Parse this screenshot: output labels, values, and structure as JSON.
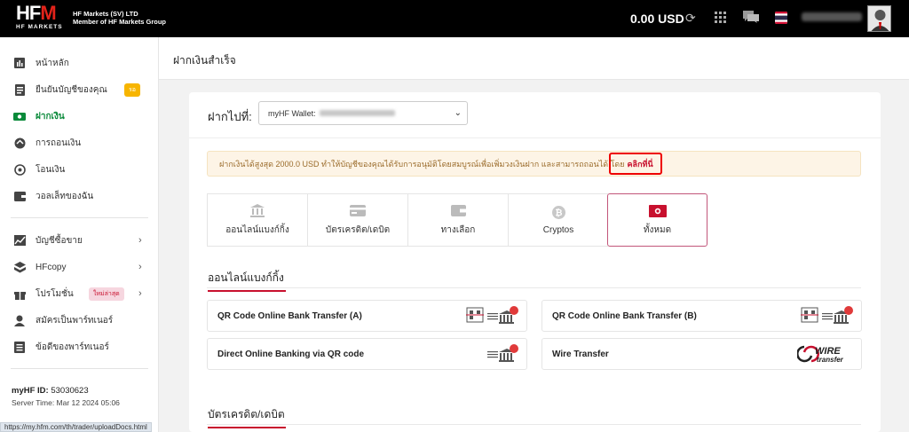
{
  "header": {
    "logo_text_main": "HF",
    "logo_text_m": "M",
    "logo_sub": "HF MARKETS",
    "company_line1": "HF Markets (SV) LTD",
    "company_line2": "Member of HF Markets Group",
    "balance": "0.00 USD",
    "icons": [
      "refresh-icon",
      "apps-icon",
      "chat-icon",
      "thai-flag-icon",
      "avatar"
    ]
  },
  "sidebar": {
    "items": [
      {
        "label": "หน้าหลัก",
        "icon": "dashboard-icon"
      },
      {
        "label": "ยืนยันบัญชีของคุณ",
        "icon": "id-card-icon",
        "badge": "รอ"
      },
      {
        "label": "ฝากเงิน",
        "icon": "deposit-icon",
        "active": true
      },
      {
        "label": "การถอนเงิน",
        "icon": "withdraw-icon"
      },
      {
        "label": "โอนเงิน",
        "icon": "transfer-icon"
      },
      {
        "label": "วอลเล็ทของฉัน",
        "icon": "wallet-icon"
      },
      {
        "label": "บัญชีซื้อขาย",
        "icon": "chart-icon"
      },
      {
        "label": "HFcopy",
        "icon": "hfcopy-icon"
      },
      {
        "label": "โปรโมชั่น",
        "icon": "gift-icon",
        "badge": "ใหม่ล่าสุด"
      },
      {
        "label": "สมัครเป็นพาร์ทเนอร์",
        "icon": "user-icon"
      },
      {
        "label": "ข้อดีของพาร์ทเนอร์",
        "icon": "list-icon"
      }
    ],
    "account_label": "myHF ID:",
    "account_id": "53030623",
    "server_time": "Server Time: Mar 12 2024 05:06"
  },
  "statusbar": {
    "url": "https://my.hfm.com/th/trader/uploadDocs.html"
  },
  "page": {
    "title": "ฝากเงินสำเร็จ",
    "deposit_to_label": "ฝากไปที่:",
    "wallet_prefix": "myHF Wallet:",
    "notice_text": "ฝากเงินได้สูงสุด 2000.0 USD ทำให้บัญชีของคุณได้รับการอนุมัติโดยสมบูรณ์เพื่อเพิ่มวงเงินฝาก และสามารถถอนได้ โดย",
    "notice_link": "คลิกที่นี่",
    "tabs": [
      {
        "label": "ออนไลน์แบงก์กิ้ง",
        "icon": "bank-icon"
      },
      {
        "label": "บัตรเครดิต/เดบิต",
        "icon": "credit-card-icon"
      },
      {
        "label": "ทางเลือก",
        "icon": "wallet-alt-icon"
      },
      {
        "label": "Cryptos",
        "icon": "bitcoin-icon"
      },
      {
        "label": "ทั้งหมด",
        "icon": "cash-icon",
        "active": true
      }
    ],
    "section_online_banking": "ออนไลน์แบงก์กิ้ง",
    "methods": [
      {
        "label": "QR Code Online Bank Transfer (A)",
        "icon": "qr-bank-icon"
      },
      {
        "label": "QR Code Online Bank Transfer (B)",
        "icon": "qr-bank-icon"
      },
      {
        "label": "Direct Online Banking via QR code",
        "icon": "bank-transfer-icon"
      },
      {
        "label": "Wire Transfer",
        "icon": "wire-transfer-logo",
        "logo_line1": "WIRE",
        "logo_line2": "transfer"
      }
    ],
    "section_cards": "บัตรเครดิต/เดบิต"
  },
  "colors": {
    "brand_red": "#c8102e",
    "active_green": "#0a8a3a",
    "topbar": "#000000",
    "notice_bg": "#fdf4e6"
  }
}
